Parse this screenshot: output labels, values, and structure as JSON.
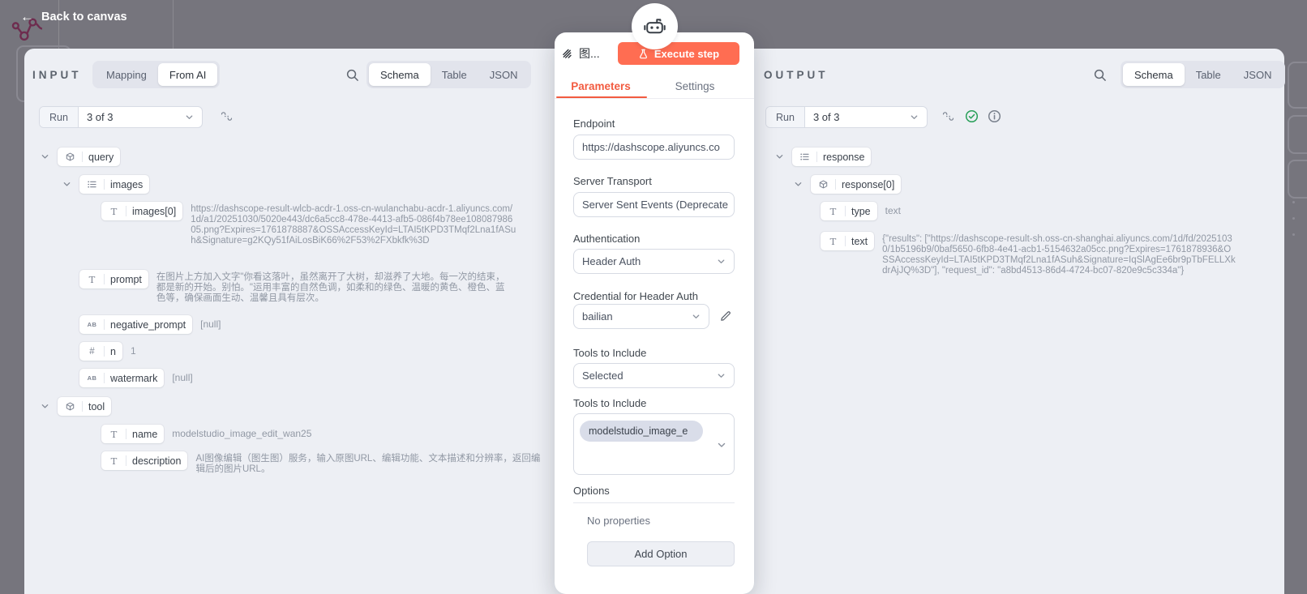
{
  "top_bar": {
    "back_label": "Back to canvas"
  },
  "input": {
    "title": "INPUT",
    "mapping_tab": "Mapping",
    "from_ai_tab": "From AI",
    "views": {
      "schema": "Schema",
      "table": "Table",
      "json": "JSON"
    },
    "run_label": "Run",
    "run_value": "3 of 3",
    "rows": {
      "query": {
        "label": "query"
      },
      "images": {
        "label": "images"
      },
      "images0": {
        "label": "images[0]",
        "value": "https://dashscope-result-wlcb-acdr-1.oss-cn-wulanchabu-acdr-1.aliyuncs.com/1d/a1/20251030/5020e443/dc6a5cc8-478e-4413-afb5-086f4b78ee10808798605.png?Expires=1761878887&OSSAccessKeyId=LTAI5tKPD3TMqf2Lna1fASuh&Signature=g2KQy51fAiLosBiK66%2F53%2FXbkfk%3D"
      },
      "prompt": {
        "label": "prompt",
        "value": "在图片上方加入文字\"你看这落叶，虽然离开了大树，却滋养了大地。每一次的结束，都是新的开始。别怕。\"运用丰富的自然色调，如柔和的绿色、温暖的黄色、橙色、蓝色等，确保画面生动、温馨且具有层次。"
      },
      "negative_prompt": {
        "label": "negative_prompt",
        "value": "[null]"
      },
      "n": {
        "label": "n",
        "value": "1"
      },
      "watermark": {
        "label": "watermark",
        "value": "[null]"
      },
      "tool": {
        "label": "tool"
      },
      "name": {
        "label": "name",
        "value": "modelstudio_image_edit_wan25"
      },
      "description": {
        "label": "description",
        "value": "AI图像编辑（图生图）服务，输入原图URL、编辑功能、文本描述和分辨率，返回编辑后的图片URL。"
      }
    }
  },
  "dialog": {
    "title": "图...",
    "execute_label": "Execute step",
    "tab_parameters": "Parameters",
    "tab_settings": "Settings",
    "endpoint": {
      "label": "Endpoint",
      "value": "https://dashscope.aliyuncs.co"
    },
    "transport": {
      "label": "Server Transport",
      "value": "Server Sent Events (Deprecate"
    },
    "auth": {
      "label": "Authentication",
      "value": "Header Auth"
    },
    "credential": {
      "label": "Credential for Header Auth",
      "value": "bailian"
    },
    "tools_mode": {
      "label": "Tools to Include",
      "value": "Selected"
    },
    "tools_list": {
      "label": "Tools to Include",
      "tag": "modelstudio_image_e"
    },
    "options": {
      "label": "Options",
      "empty": "No properties",
      "add": "Add Option"
    }
  },
  "output": {
    "title": "OUTPUT",
    "views": {
      "schema": "Schema",
      "table": "Table",
      "json": "JSON"
    },
    "run_label": "Run",
    "run_value": "3 of 3",
    "rows": {
      "response": {
        "label": "response"
      },
      "response0": {
        "label": "response[0]"
      },
      "type": {
        "label": "type",
        "value": "text"
      },
      "text": {
        "label": "text",
        "value": "{\"results\": [\"https://dashscope-result-sh.oss-cn-shanghai.aliyuncs.com/1d/fd/20251030/1b5196b9/0baf5650-6fb8-4e41-acb1-5154632a05cc.png?Expires=1761878936&OSSAccessKeyId=LTAI5tKPD3TMqf2Lna1fASuh&Signature=IqSlAgEe6br9pTbFELLXkdrAjJQ%3D\"], \"request_id\": \"a8bd4513-86d4-4724-bc07-820e9c5c334a\"}"
      }
    }
  }
}
